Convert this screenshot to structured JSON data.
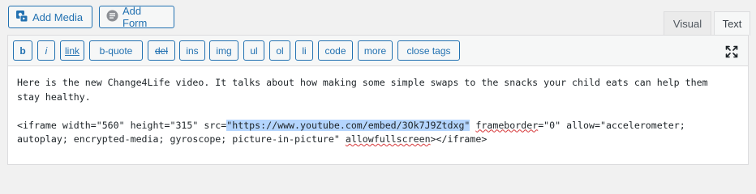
{
  "media_buttons": {
    "add_media": "Add Media",
    "add_form": "Add Form"
  },
  "tabs": {
    "visual": "Visual",
    "text": "Text",
    "active": "Text"
  },
  "quicktags": [
    "b",
    "i",
    "link",
    "b-quote",
    "del",
    "ins",
    "img",
    "ul",
    "ol",
    "li",
    "code",
    "more",
    "close tags"
  ],
  "content": {
    "line1": "Here is the new Change4Life video. It talks about how making some simple swaps to the snacks your child eats can help them",
    "line2": "stay healthy.",
    "line3_pre": "<iframe width=\"560\" height=\"315\" src=",
    "line3_selected": "\"https://www.youtube.com/embed/3Ok7J9Ztdxg\"",
    "line3_space": " ",
    "line3_squiggle": "frameborder",
    "line3_post": "=\"0\" allow=\"accelerometer;",
    "line4_pre": "autoplay; encrypted-media; gyroscope; picture-in-picture\" ",
    "line4_squiggle": "allowfullscreen",
    "line4_post": "></iframe>"
  },
  "icons": {
    "add_media": "media-camera-icon",
    "add_form": "form-icon",
    "fullscreen": "fullscreen-icon"
  },
  "colors": {
    "accent": "#2271b1",
    "selection": "#b4d5fe",
    "spellcheck": "#d63638"
  }
}
